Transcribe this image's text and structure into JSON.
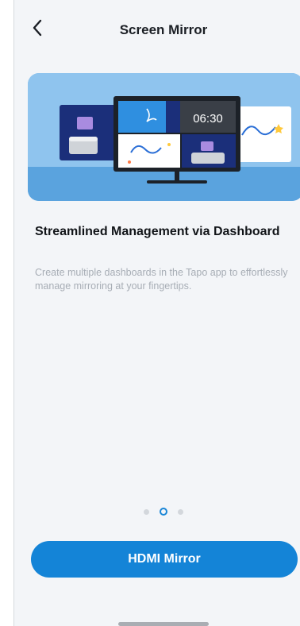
{
  "header": {
    "title": "Screen Mirror",
    "back_icon": "chevron-left-icon"
  },
  "hero": {
    "clock_text": "06:30",
    "colors": {
      "backdrop": "#8fc4ee",
      "floor": "#5aa3de",
      "monitor": "#1c2128",
      "accent_purple": "#a98be0",
      "accent_orange": "#ff7a45",
      "accent_yellow": "#ffc93c"
    }
  },
  "content": {
    "heading": "Streamlined Management via Dashboard",
    "description": "Create multiple dashboards in the Tapo app to effortlessly manage mirroring at your fingertips."
  },
  "pagination": {
    "total": 3,
    "current": 2
  },
  "cta": {
    "label": "HDMI Mirror",
    "color": "#1484d7"
  }
}
